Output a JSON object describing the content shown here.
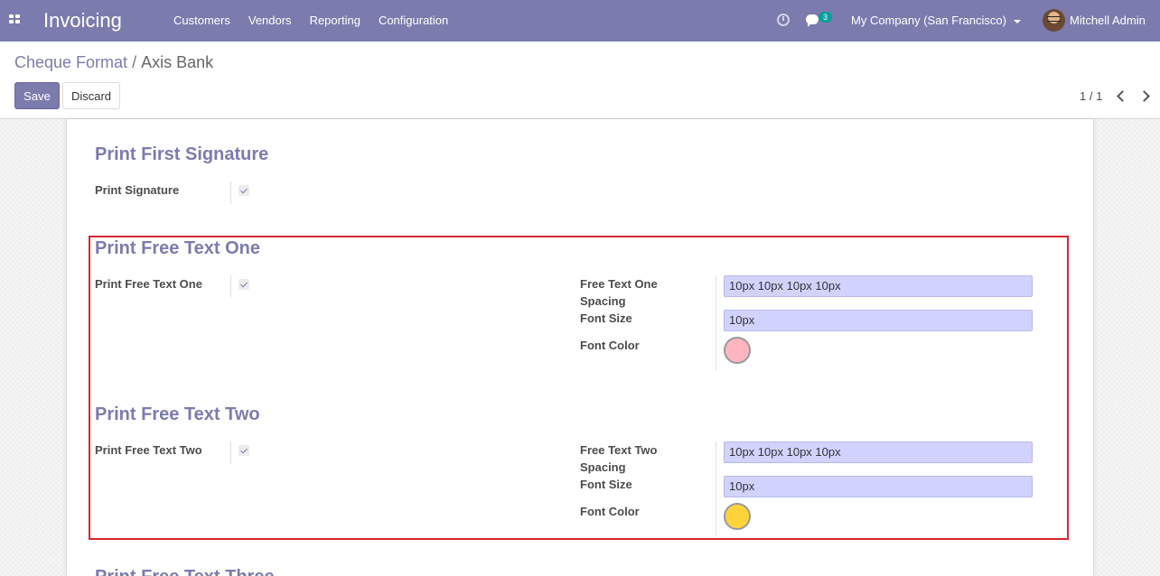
{
  "navbar": {
    "app_title": "Invoicing",
    "menu": [
      "Customers",
      "Vendors",
      "Reporting",
      "Configuration"
    ],
    "message_count": "3",
    "company": "My Company (San Francisco)",
    "user": "Mitchell Admin"
  },
  "breadcrumb": {
    "parent": "Cheque Format",
    "separator": "/",
    "current": "Axis Bank"
  },
  "buttons": {
    "save": "Save",
    "discard": "Discard"
  },
  "pager": {
    "value": "1 / 1"
  },
  "sections": {
    "first_signature": {
      "title": "Print First Signature",
      "print_label": "Print Signature",
      "print_checked": true
    },
    "free_text_one": {
      "title": "Print Free Text One",
      "print_label": "Print Free Text One",
      "print_checked": true,
      "spacing_label_line1": "Free Text One",
      "spacing_label_line2": "Spacing",
      "spacing_value": "10px 10px 10px 10px",
      "font_size_label": "Font Size",
      "font_size_value": "10px",
      "font_color_label": "Font Color",
      "font_color": "#ffb6c1"
    },
    "free_text_two": {
      "title": "Print Free Text Two",
      "print_label": "Print Free Text Two",
      "print_checked": true,
      "spacing_label_line1": "Free Text Two",
      "spacing_label_line2": "Spacing",
      "spacing_value": "10px 10px 10px 10px",
      "font_size_label": "Font Size",
      "font_size_value": "10px",
      "font_color_label": "Font Color",
      "font_color": "#ffd43b"
    },
    "free_text_three": {
      "title": "Print Free Text Three"
    }
  },
  "colors": {
    "brand": "#7c7bad",
    "highlight_border": "#d9262a",
    "input_background": "#d2d2ff"
  }
}
